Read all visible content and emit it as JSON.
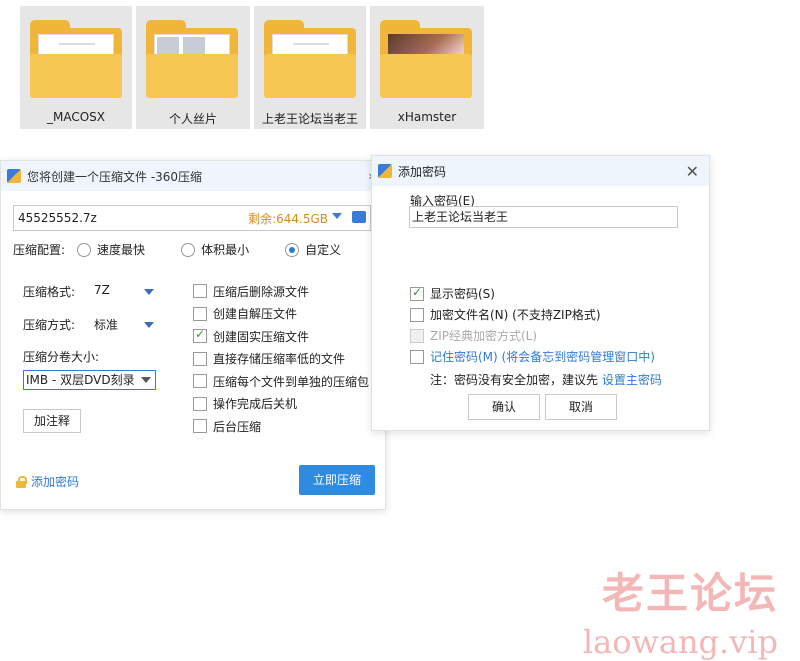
{
  "folders": [
    {
      "label": "_MACOSX",
      "type": "doc"
    },
    {
      "label": "个人丝片",
      "type": "thumbs"
    },
    {
      "label": "上老王论坛当老王",
      "type": "doc"
    },
    {
      "label": "xHamster",
      "type": "photo"
    }
  ],
  "compress_dialog": {
    "title": "您将创建一个压缩文件 -360压缩",
    "file_name": "45525552.7z",
    "remaining": "剩余:644.5GB",
    "config_label": "压缩配置:",
    "modes": [
      "速度最快",
      "体积最小",
      "自定义"
    ],
    "selected_mode": "自定义",
    "format_label": "压缩格式:",
    "format_value": "7Z",
    "method_label": "压缩方式:",
    "method_value": "标准",
    "volume_label": "压缩分卷大小:",
    "volume_value": "IMB  - 双层DVD刻录",
    "note_button": "加注释",
    "options": [
      {
        "label": "压缩后删除源文件",
        "checked": false
      },
      {
        "label": "创建自解压文件",
        "checked": false
      },
      {
        "label": "创建固实压缩文件",
        "checked": true
      },
      {
        "label": "直接存储压缩率低的文件",
        "checked": false
      },
      {
        "label": "压缩每个文件到单独的压缩包",
        "checked": false
      },
      {
        "label": "操作完成后关机",
        "checked": false
      },
      {
        "label": "后台压缩",
        "checked": false
      }
    ],
    "add_password": "添加密码",
    "compress_button": "立即压缩"
  },
  "password_dialog": {
    "title": "添加密码",
    "input_label": "输入密码(E)",
    "password_value": "上老王论坛当老王",
    "options": [
      {
        "label": "显示密码(S)",
        "checked": true,
        "disabled": false
      },
      {
        "label": "加密文件名(N) (不支持ZIP格式)",
        "checked": false,
        "disabled": false
      },
      {
        "label": "ZIP经典加密方式(L)",
        "checked": false,
        "disabled": true
      },
      {
        "label": "记住密码(M) (将会备忘到密码管理窗口中)",
        "checked": false,
        "disabled": false
      }
    ],
    "note_prefix": "注：密码没有安全加密，建议先",
    "note_link": "设置主密码",
    "ok_button": "确认",
    "cancel_button": "取消"
  },
  "watermark": {
    "logo": "老王论坛",
    "url": "laowang.vip"
  },
  "colors": {
    "accent": "#2f8be0",
    "folder": "#f0b63a",
    "remaining": "#e08a1e",
    "watermark": "#f3b7b7"
  }
}
